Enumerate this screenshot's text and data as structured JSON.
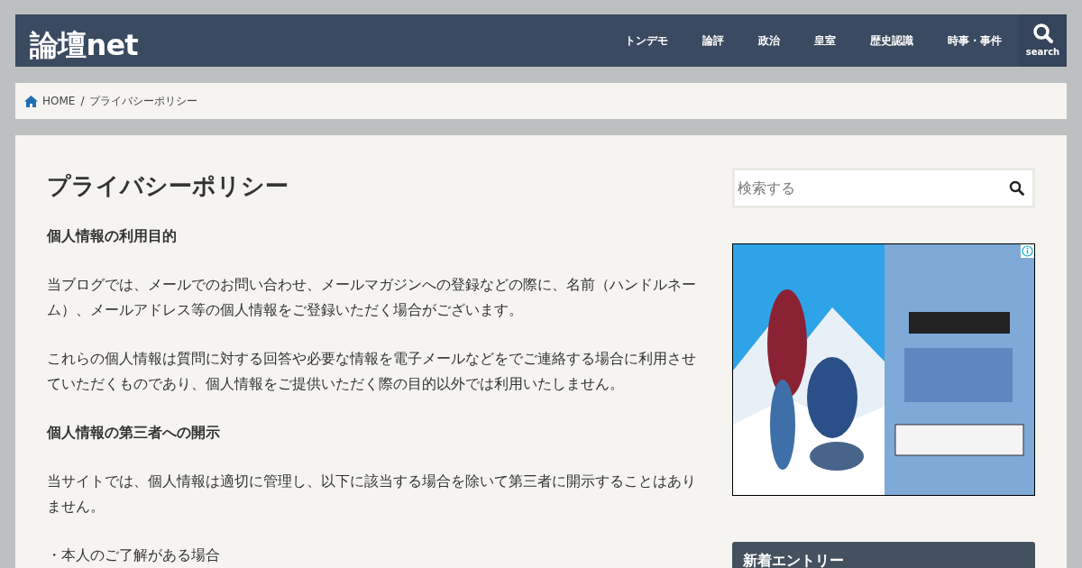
{
  "header": {
    "logo": "論壇net",
    "nav": [
      {
        "label": "トンデモ"
      },
      {
        "label": "論評"
      },
      {
        "label": "政治"
      },
      {
        "label": "皇室"
      },
      {
        "label": "歴史認識"
      },
      {
        "label": "時事・事件"
      }
    ],
    "search_label": "search"
  },
  "breadcrumb": [
    "HOME",
    "/",
    "プライバシーポリシー"
  ],
  "article": {
    "title": "プライバシーポリシー",
    "blocks": [
      {
        "kind": "heading",
        "text": "個人情報の利用目的"
      },
      {
        "kind": "paragraph",
        "text": "当ブログでは、メールでのお問い合わせ、メールマガジンへの登録などの際に、名前（ハンドルネーム）、メールアドレス等の個人情報をご登録いただく場合がございます。"
      },
      {
        "kind": "paragraph",
        "text": "これらの個人情報は質問に対する回答や必要な情報を電子メールなどをでご連絡する場合に利用させていただくものであり、個人情報をご提供いただく際の目的以外では利用いたしません。"
      },
      {
        "kind": "heading",
        "text": "個人情報の第三者への開示"
      },
      {
        "kind": "paragraph",
        "text": "当サイトでは、個人情報は適切に管理し、以下に該当する場合を除いて第三者に開示することはありません。"
      },
      {
        "kind": "paragraph",
        "text": "・本人のご了解がある場合"
      }
    ]
  },
  "sidebar": {
    "search": {
      "placeholder": "検索する"
    },
    "widget_title": "新着エントリー"
  }
}
